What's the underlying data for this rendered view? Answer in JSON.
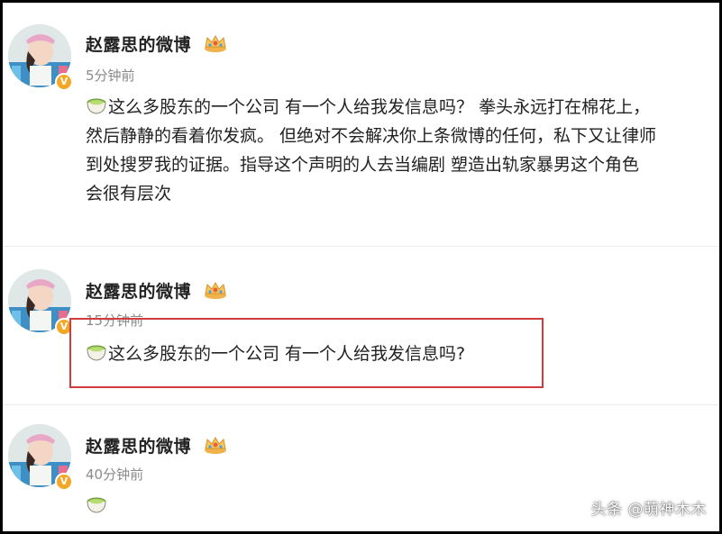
{
  "posts": [
    {
      "username": "赵露思的微博",
      "time": "5分钟前",
      "lines": [
        "这么多股东的一个公司 有一个人给我发信息吗？ 拳头永远打在棉花上，",
        "然后静静的看着你发疯。 但绝对不会解决你上条微博的任何，私下又让律师",
        "到处搜罗我的证据。指导这个声明的人去当编剧 塑造出轨家暴男这个角色",
        "会很有层次"
      ]
    },
    {
      "username": "赵露思的微博",
      "time": "15分钟前",
      "lines": [
        "这么多股东的一个公司 有一个人给我发信息吗?"
      ]
    },
    {
      "username": "赵露思的微博",
      "time": "40分钟前",
      "lines": [
        ""
      ]
    }
  ],
  "watermark": "头条 @萌神木木",
  "colors": {
    "highlight": "#d43a3a",
    "verified": "#f5a623",
    "frame": "#000000"
  },
  "icons": [
    "avatar",
    "verified-badge-icon",
    "crown-icon",
    "matcha-emoji-icon"
  ]
}
